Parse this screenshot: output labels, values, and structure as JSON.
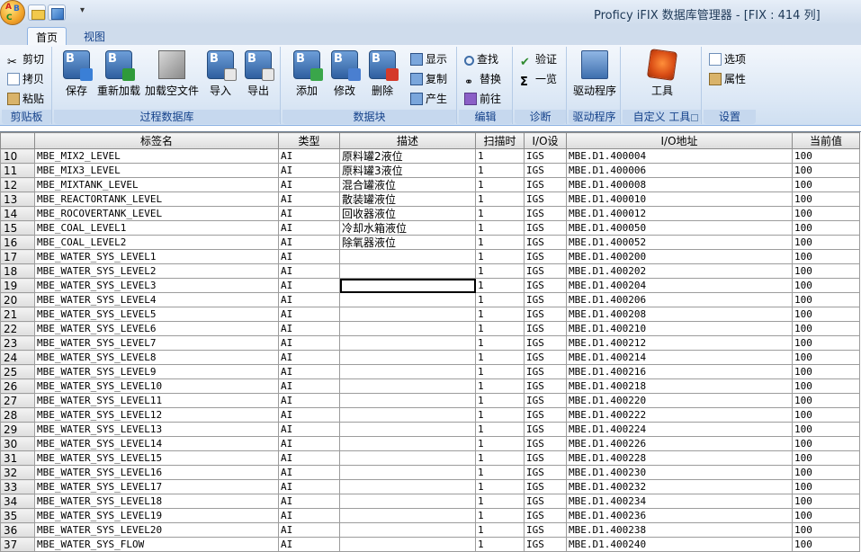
{
  "window": {
    "title": "Proficy iFIX 数据库管理器 - [FIX : 414 列]"
  },
  "tabs": [
    {
      "label": "首页"
    },
    {
      "label": "视图"
    }
  ],
  "ribbon": {
    "clipboard": {
      "cut": "剪切",
      "copy": "拷贝",
      "paste": "粘贴",
      "group": "剪贴板"
    },
    "process_db": {
      "save": "保存",
      "reload": "重新加载",
      "load_empty": "加载空文件",
      "import": "导入",
      "export": "导出",
      "group": "过程数据库"
    },
    "blocks": {
      "add": "添加",
      "modify": "修改",
      "delete": "删除",
      "show": "显示",
      "copy": "复制",
      "generate": "产生",
      "group": "数据块"
    },
    "edit": {
      "find": "查找",
      "replace": "替换",
      "goto": "前往",
      "group": "编辑"
    },
    "diagnose": {
      "verify": "验证",
      "overview": "一览",
      "group": "诊断"
    },
    "drivers": {
      "driver": "驱动程序",
      "group": "驱动程序"
    },
    "custom": {
      "tools": "工具",
      "group": "自定义 工具"
    },
    "settings": {
      "options": "选项",
      "properties": "属性",
      "group": "设置"
    }
  },
  "grid": {
    "columns": [
      "标签名",
      "类型",
      "描述",
      "扫描时",
      "I/O设",
      "I/O地址",
      "当前值"
    ],
    "rows": [
      {
        "n": "10",
        "tag": "MBE_MIX2_LEVEL",
        "type": "AI",
        "desc": "原料罐2液位",
        "scan": "1",
        "io": "IGS",
        "addr": "MBE.D1.400004",
        "val": "100"
      },
      {
        "n": "11",
        "tag": "MBE_MIX3_LEVEL",
        "type": "AI",
        "desc": "原料罐3液位",
        "scan": "1",
        "io": "IGS",
        "addr": "MBE.D1.400006",
        "val": "100"
      },
      {
        "n": "12",
        "tag": "MBE_MIXTANK_LEVEL",
        "type": "AI",
        "desc": "混合罐液位",
        "scan": "1",
        "io": "IGS",
        "addr": "MBE.D1.400008",
        "val": "100"
      },
      {
        "n": "13",
        "tag": "MBE_REACTORTANK_LEVEL",
        "type": "AI",
        "desc": "散装罐液位",
        "scan": "1",
        "io": "IGS",
        "addr": "MBE.D1.400010",
        "val": "100"
      },
      {
        "n": "14",
        "tag": "MBE_ROCOVERTANK_LEVEL",
        "type": "AI",
        "desc": "回收器液位",
        "scan": "1",
        "io": "IGS",
        "addr": "MBE.D1.400012",
        "val": "100"
      },
      {
        "n": "15",
        "tag": "MBE_COAL_LEVEL1",
        "type": "AI",
        "desc": "冷却水箱液位",
        "scan": "1",
        "io": "IGS",
        "addr": "MBE.D1.400050",
        "val": "100"
      },
      {
        "n": "16",
        "tag": "MBE_COAL_LEVEL2",
        "type": "AI",
        "desc": "除氧器液位",
        "scan": "1",
        "io": "IGS",
        "addr": "MBE.D1.400052",
        "val": "100"
      },
      {
        "n": "17",
        "tag": "MBE_WATER_SYS_LEVEL1",
        "type": "AI",
        "desc": "",
        "scan": "1",
        "io": "IGS",
        "addr": "MBE.D1.400200",
        "val": "100"
      },
      {
        "n": "18",
        "tag": "MBE_WATER_SYS_LEVEL2",
        "type": "AI",
        "desc": "",
        "scan": "1",
        "io": "IGS",
        "addr": "MBE.D1.400202",
        "val": "100"
      },
      {
        "n": "19",
        "tag": "MBE_WATER_SYS_LEVEL3",
        "type": "AI",
        "desc": "",
        "scan": "1",
        "io": "IGS",
        "addr": "MBE.D1.400204",
        "val": "100",
        "selected": true
      },
      {
        "n": "20",
        "tag": "MBE_WATER_SYS_LEVEL4",
        "type": "AI",
        "desc": "",
        "scan": "1",
        "io": "IGS",
        "addr": "MBE.D1.400206",
        "val": "100"
      },
      {
        "n": "21",
        "tag": "MBE_WATER_SYS_LEVEL5",
        "type": "AI",
        "desc": "",
        "scan": "1",
        "io": "IGS",
        "addr": "MBE.D1.400208",
        "val": "100"
      },
      {
        "n": "22",
        "tag": "MBE_WATER_SYS_LEVEL6",
        "type": "AI",
        "desc": "",
        "scan": "1",
        "io": "IGS",
        "addr": "MBE.D1.400210",
        "val": "100"
      },
      {
        "n": "23",
        "tag": "MBE_WATER_SYS_LEVEL7",
        "type": "AI",
        "desc": "",
        "scan": "1",
        "io": "IGS",
        "addr": "MBE.D1.400212",
        "val": "100"
      },
      {
        "n": "24",
        "tag": "MBE_WATER_SYS_LEVEL8",
        "type": "AI",
        "desc": "",
        "scan": "1",
        "io": "IGS",
        "addr": "MBE.D1.400214",
        "val": "100"
      },
      {
        "n": "25",
        "tag": "MBE_WATER_SYS_LEVEL9",
        "type": "AI",
        "desc": "",
        "scan": "1",
        "io": "IGS",
        "addr": "MBE.D1.400216",
        "val": "100"
      },
      {
        "n": "26",
        "tag": "MBE_WATER_SYS_LEVEL10",
        "type": "AI",
        "desc": "",
        "scan": "1",
        "io": "IGS",
        "addr": "MBE.D1.400218",
        "val": "100"
      },
      {
        "n": "27",
        "tag": "MBE_WATER_SYS_LEVEL11",
        "type": "AI",
        "desc": "",
        "scan": "1",
        "io": "IGS",
        "addr": "MBE.D1.400220",
        "val": "100"
      },
      {
        "n": "28",
        "tag": "MBE_WATER_SYS_LEVEL12",
        "type": "AI",
        "desc": "",
        "scan": "1",
        "io": "IGS",
        "addr": "MBE.D1.400222",
        "val": "100"
      },
      {
        "n": "29",
        "tag": "MBE_WATER_SYS_LEVEL13",
        "type": "AI",
        "desc": "",
        "scan": "1",
        "io": "IGS",
        "addr": "MBE.D1.400224",
        "val": "100"
      },
      {
        "n": "30",
        "tag": "MBE_WATER_SYS_LEVEL14",
        "type": "AI",
        "desc": "",
        "scan": "1",
        "io": "IGS",
        "addr": "MBE.D1.400226",
        "val": "100"
      },
      {
        "n": "31",
        "tag": "MBE_WATER_SYS_LEVEL15",
        "type": "AI",
        "desc": "",
        "scan": "1",
        "io": "IGS",
        "addr": "MBE.D1.400228",
        "val": "100"
      },
      {
        "n": "32",
        "tag": "MBE_WATER_SYS_LEVEL16",
        "type": "AI",
        "desc": "",
        "scan": "1",
        "io": "IGS",
        "addr": "MBE.D1.400230",
        "val": "100"
      },
      {
        "n": "33",
        "tag": "MBE_WATER_SYS_LEVEL17",
        "type": "AI",
        "desc": "",
        "scan": "1",
        "io": "IGS",
        "addr": "MBE.D1.400232",
        "val": "100"
      },
      {
        "n": "34",
        "tag": "MBE_WATER_SYS_LEVEL18",
        "type": "AI",
        "desc": "",
        "scan": "1",
        "io": "IGS",
        "addr": "MBE.D1.400234",
        "val": "100"
      },
      {
        "n": "35",
        "tag": "MBE_WATER_SYS_LEVEL19",
        "type": "AI",
        "desc": "",
        "scan": "1",
        "io": "IGS",
        "addr": "MBE.D1.400236",
        "val": "100"
      },
      {
        "n": "36",
        "tag": "MBE_WATER_SYS_LEVEL20",
        "type": "AI",
        "desc": "",
        "scan": "1",
        "io": "IGS",
        "addr": "MBE.D1.400238",
        "val": "100"
      },
      {
        "n": "37",
        "tag": "MBE_WATER_SYS_FLOW",
        "type": "AI",
        "desc": "",
        "scan": "1",
        "io": "IGS",
        "addr": "MBE.D1.400240",
        "val": "100"
      }
    ]
  }
}
